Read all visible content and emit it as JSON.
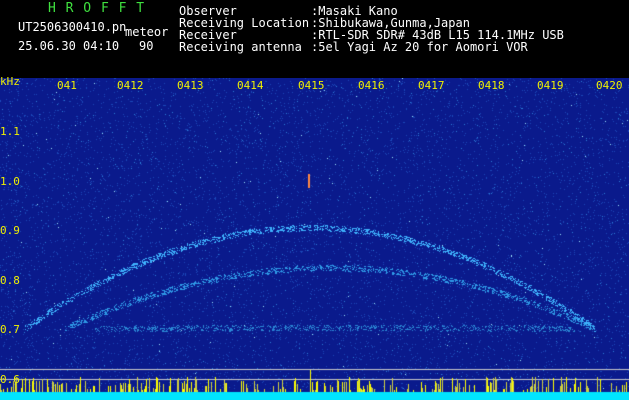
{
  "header": {
    "app_name": "H R O F F T",
    "filename": "UT2506300410.pn",
    "mode": "meteor",
    "datetime": "25.06.30 04:10",
    "interval": "90",
    "info_labels": [
      "Observer",
      "Receiving Location",
      "Receiver",
      "Receiving antenna"
    ],
    "info_values": [
      ":Masaki Kano",
      ":Shibukawa,Gunma,Japan",
      ":RTL-SDR SDR# 43dB L15 114.1MHz USB",
      ":5el Yagi Az 20 for Aomori VOR"
    ]
  },
  "axes": {
    "y_unit": "kHz",
    "y_ticks": [
      "1.1",
      "1.0",
      "0.9",
      "0.8",
      "0.7",
      "0.6"
    ],
    "x_ticks": [
      "041",
      "0412",
      "0413",
      "0414",
      "0415",
      "0416",
      "0417",
      "0418",
      "0419",
      "0420"
    ]
  },
  "colors": {
    "background": "#000000",
    "spectrum_base": "#0a1a8c",
    "title_green": "#3fe03f",
    "label_yellow": "#f0f000",
    "noise_floor": "#00e5ff",
    "noise_peaks": "#ffff00",
    "reference_lines": "#c8c8c8"
  }
}
